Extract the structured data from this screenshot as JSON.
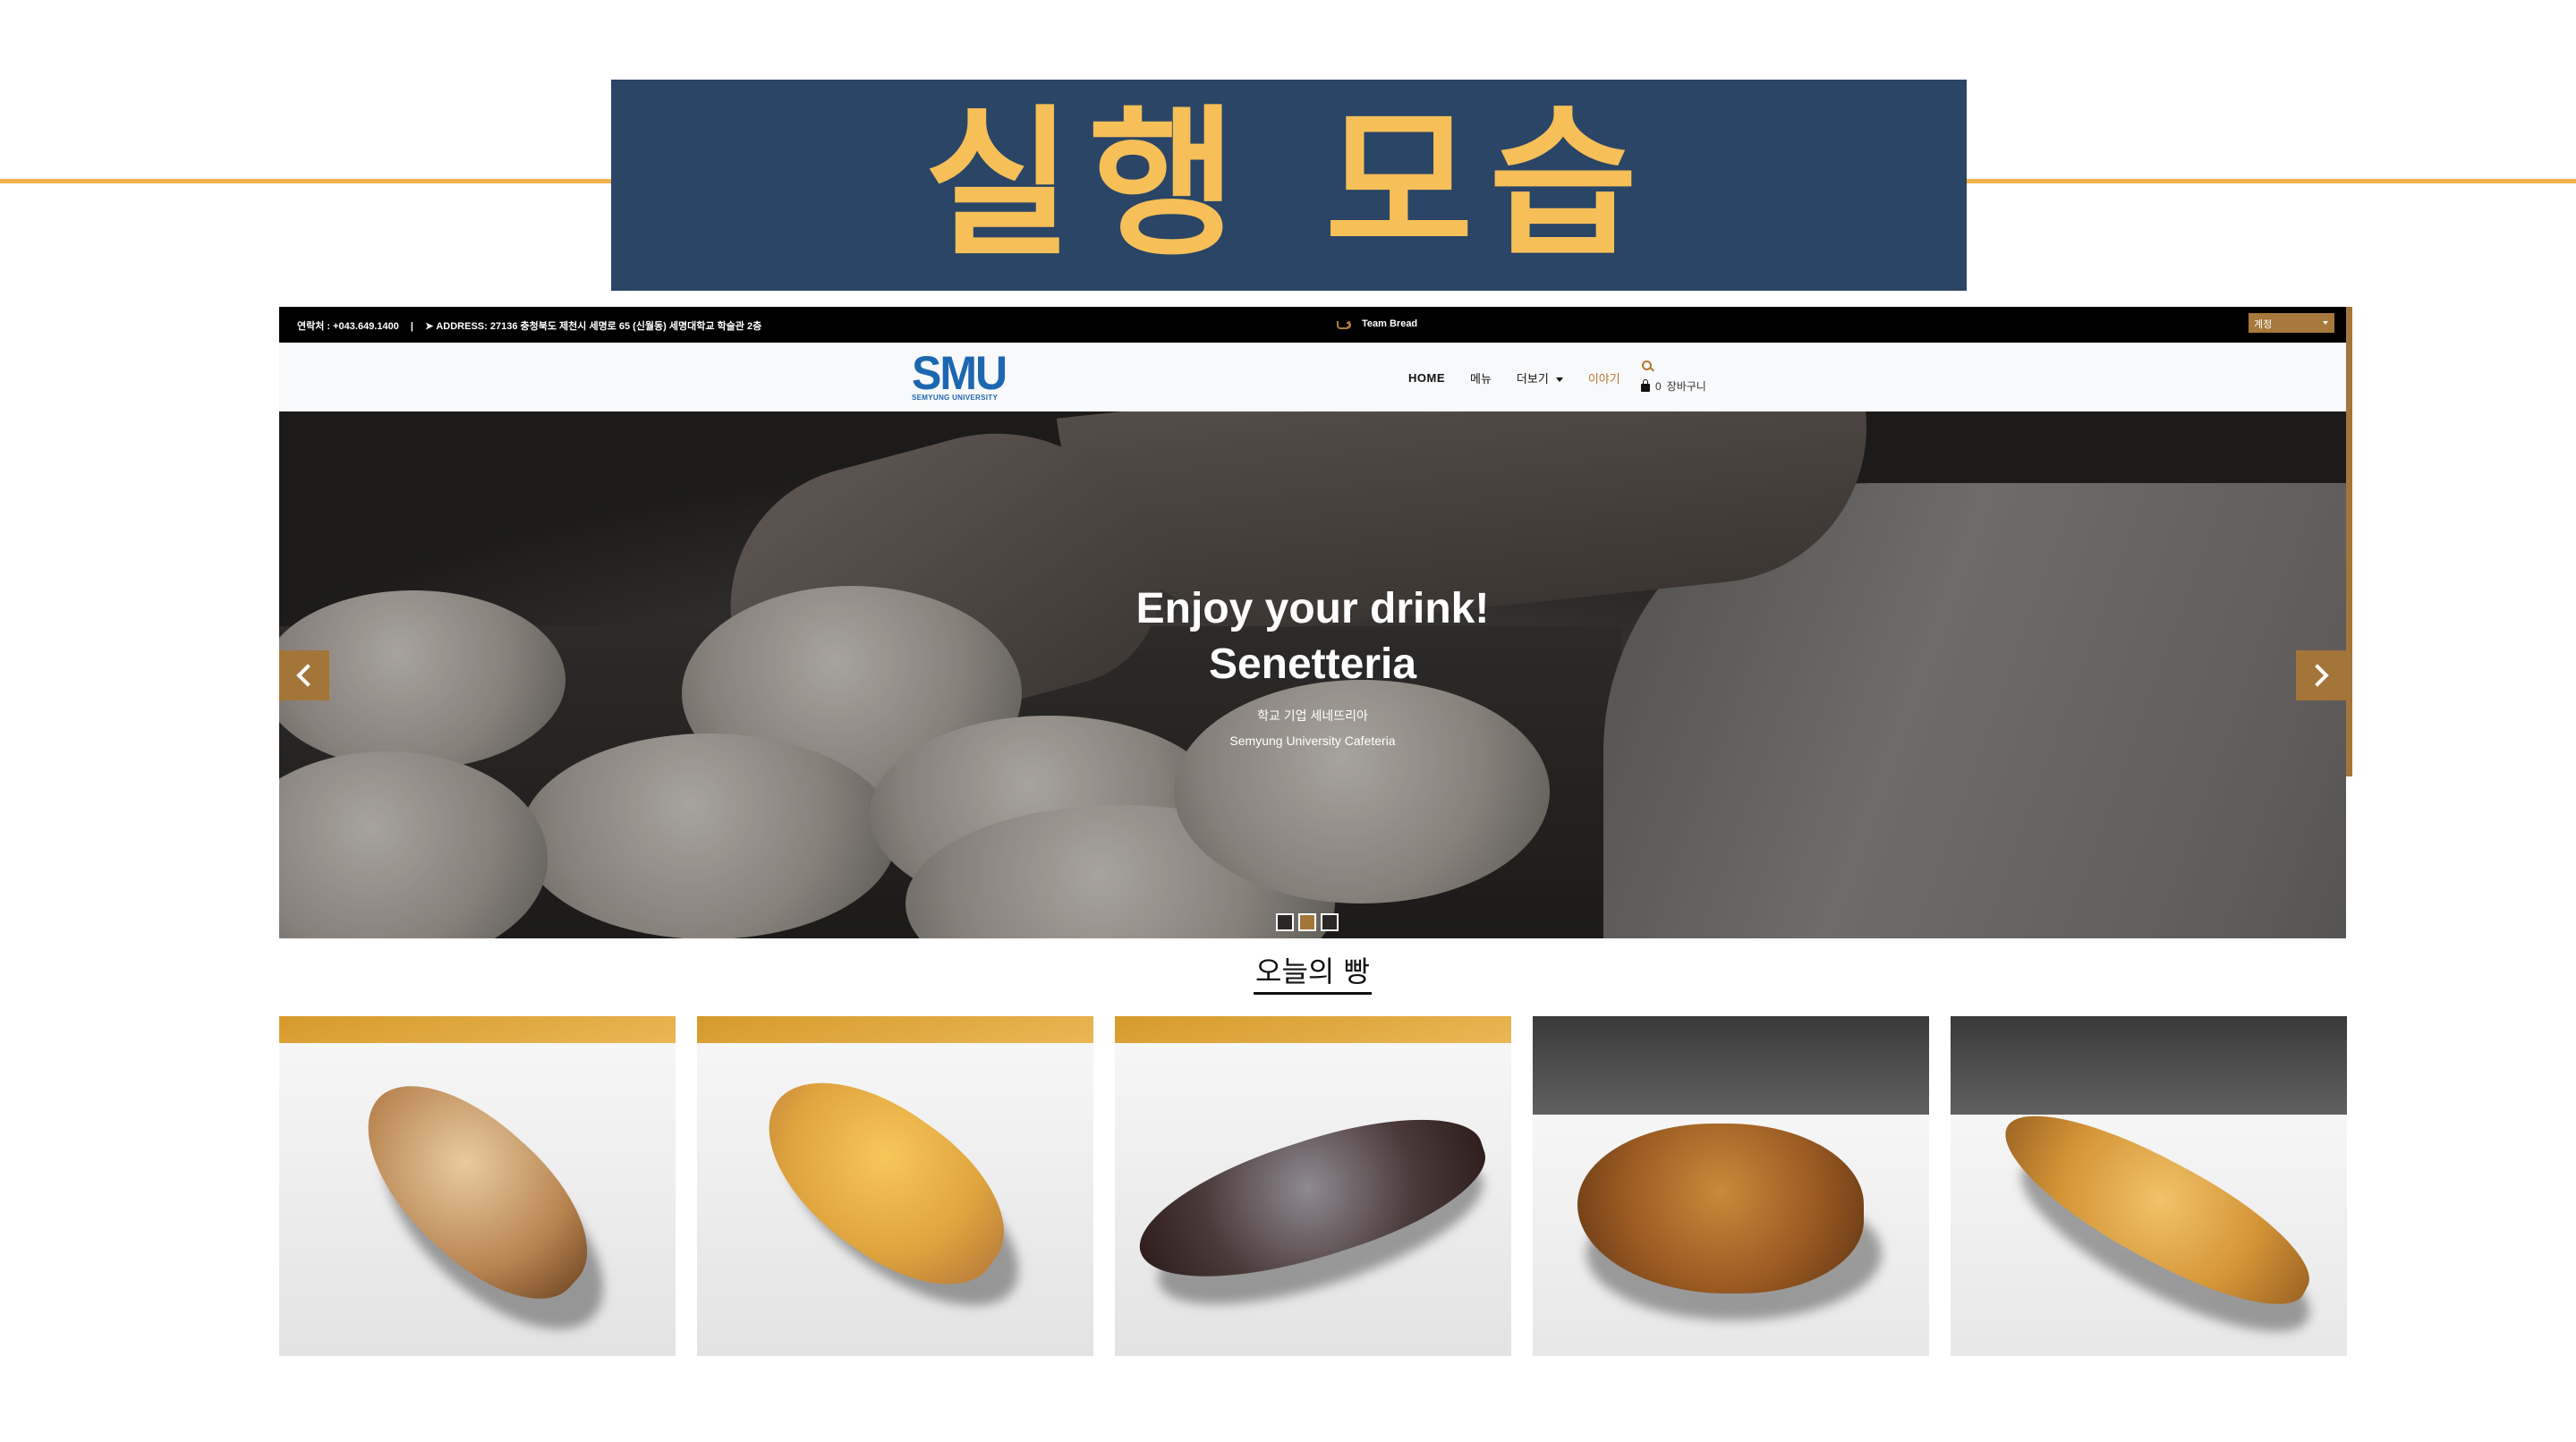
{
  "slide": {
    "title": "실행 모습",
    "accent_color": "#f2b24b",
    "banner_color": "#2a4565",
    "title_color": "#f6bf58"
  },
  "topbar": {
    "contact": "연락처 : +043.649.1400",
    "address": "ADDRESS: 27136 충청북도 제천시 세명로 65 (신월동) 세명대학교 학술관 2층",
    "brand": "Team Bread",
    "language": "계정"
  },
  "navbar": {
    "logo_text": "SMU",
    "logo_sub": "SEMYUNG UNIVERSITY",
    "items": [
      "HOME",
      "메뉴",
      "더보기",
      "이야기"
    ],
    "cart_count": "0",
    "cart_label": "장바구니",
    "brand_color": "#a47538"
  },
  "hero": {
    "title_line1": "Enjoy your drink!",
    "title_line2": "Senetteria",
    "subtitle_ko": "학교 기업 세네뜨리아",
    "subtitle_en": "Semyung University Cafeteria",
    "active_slide": 2,
    "slide_count": 3
  },
  "section": {
    "title": "오늘의 빵"
  },
  "breads": [
    {
      "icon": "crumble-scone"
    },
    {
      "icon": "glazed-scone"
    },
    {
      "icon": "chocolate-almond-croissant"
    },
    {
      "icon": "nut-topped-pastry"
    },
    {
      "icon": "cheese-bread-stick"
    }
  ]
}
